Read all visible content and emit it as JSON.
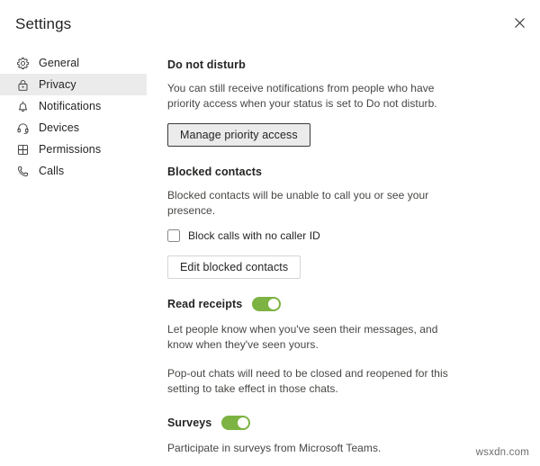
{
  "header": {
    "title": "Settings",
    "close_icon": "close-icon"
  },
  "sidebar": {
    "items": [
      {
        "id": "general",
        "label": "General",
        "icon": "gear-icon",
        "selected": false
      },
      {
        "id": "privacy",
        "label": "Privacy",
        "icon": "lock-icon",
        "selected": true
      },
      {
        "id": "notifications",
        "label": "Notifications",
        "icon": "bell-icon",
        "selected": false
      },
      {
        "id": "devices",
        "label": "Devices",
        "icon": "headset-icon",
        "selected": false
      },
      {
        "id": "permissions",
        "label": "Permissions",
        "icon": "apps-grid-icon",
        "selected": false
      },
      {
        "id": "calls",
        "label": "Calls",
        "icon": "phone-icon",
        "selected": false
      }
    ]
  },
  "main": {
    "do_not_disturb": {
      "heading": "Do not disturb",
      "description": "You can still receive notifications from people who have priority access when your status is set to Do not disturb.",
      "button_label": "Manage priority access"
    },
    "blocked_contacts": {
      "heading": "Blocked contacts",
      "description": "Blocked contacts will be unable to call you or see your presence.",
      "checkbox_label": "Block calls with no caller ID",
      "checkbox_checked": false,
      "button_label": "Edit blocked contacts"
    },
    "read_receipts": {
      "heading": "Read receipts",
      "toggle_state": "on",
      "description_1": "Let people know when you've seen their messages, and know when they've seen yours.",
      "description_2": "Pop-out chats will need to be closed and reopened for this setting to take effect in those chats."
    },
    "surveys": {
      "heading": "Surveys",
      "toggle_state": "on",
      "description": "Participate in surveys from Microsoft Teams."
    }
  },
  "watermark": {
    "text": "wsxdn.com"
  },
  "colors": {
    "toggle_on": "#7cb342",
    "selected_nav_bg": "#ebebeb",
    "focus_border": "#3b3a39",
    "body_text": "#484644"
  }
}
